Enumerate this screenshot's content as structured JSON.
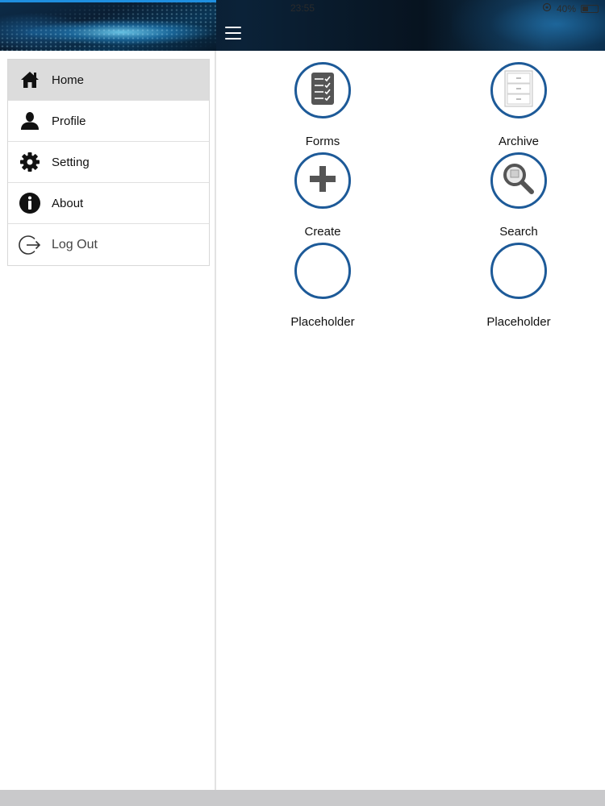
{
  "status_bar": {
    "time": "23:55",
    "battery_text": "40%",
    "battery_level": 0.4
  },
  "sidebar": {
    "items": [
      {
        "label": "Home",
        "icon": "home-icon",
        "active": true
      },
      {
        "label": "Profile",
        "icon": "user-icon",
        "active": false
      },
      {
        "label": "Setting",
        "icon": "gear-icon",
        "active": false
      },
      {
        "label": "About",
        "icon": "info-icon",
        "active": false
      },
      {
        "label": "Log Out",
        "icon": "logout-icon",
        "active": false
      }
    ]
  },
  "main": {
    "tiles": [
      {
        "label": "Forms",
        "icon": "checklist-icon"
      },
      {
        "label": "Archive",
        "icon": "cabinet-icon"
      },
      {
        "label": "Create",
        "icon": "plus-icon"
      },
      {
        "label": "Search",
        "icon": "magnifier-icon"
      },
      {
        "label": "Placeholder",
        "icon": "empty"
      },
      {
        "label": "Placeholder",
        "icon": "empty"
      }
    ]
  },
  "colors": {
    "accent": "#1d5a98",
    "active_row": "#dcdcdc",
    "header_blue": "#1f8fe0"
  }
}
